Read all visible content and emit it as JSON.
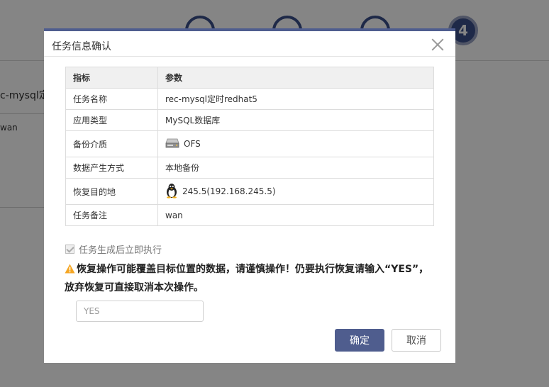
{
  "background": {
    "active_step": "4",
    "task_name_partial": "c-mysql定",
    "note_partial": "wan"
  },
  "modal": {
    "title": "任务信息确认",
    "table": {
      "headers": [
        "指标",
        "参数"
      ],
      "rows": [
        {
          "label": "任务名称",
          "value": "rec-mysql定时redhat5"
        },
        {
          "label": "应用类型",
          "value": "MySQL数据库"
        },
        {
          "label": "备份介质",
          "value": "OFS",
          "icon": "storage-drive-icon"
        },
        {
          "label": "数据产生方式",
          "value": "本地备份"
        },
        {
          "label": "恢复目的地",
          "value": "245.5(192.168.245.5)",
          "icon": "linux-penguin-icon"
        },
        {
          "label": "任务备注",
          "value": "wan"
        }
      ]
    },
    "execute_immediately": {
      "label": "任务生成后立即执行",
      "checked": true,
      "disabled": true
    },
    "warning": {
      "icon": "warning-triangle-icon",
      "text": "恢复操作可能覆盖目标位置的数据，请谨慎操作！仍要执行恢复请输入“YES”，放弃恢复可直接取消本次操作。"
    },
    "confirm_input": {
      "value": "",
      "placeholder": "YES"
    },
    "buttons": {
      "ok": "确定",
      "cancel": "取消"
    }
  },
  "colors": {
    "primary": "#4f5d8e",
    "warning": "#f5a623"
  }
}
